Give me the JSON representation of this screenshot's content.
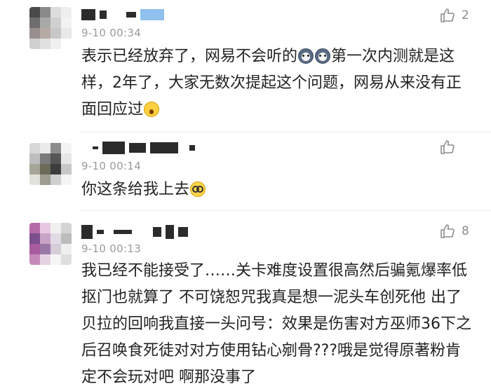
{
  "comments": [
    {
      "time": "9-10 00:34",
      "text_before_emoji": "表示已经放弃了，网易不会听的",
      "emojis": [
        "husky-emoji",
        "husky-emoji"
      ],
      "text_after_emoji": "第一次内测就是这样，2年了，大家无数次提起这个问题，网易从来没有正面回应过",
      "trailing_emoji": "scream-emoji",
      "like_count": "2",
      "avatar_colors": [
        "#4a4a4a",
        "#8a8a8a",
        "#dcdcdc",
        "#eeeeee",
        "#6e6e6e",
        "#a9a9a9",
        "#d0d0d0",
        "#f2f2f2",
        "#9a8f8f",
        "#b6aaa5",
        "#c8c8c8",
        "#e8e8e8",
        "#cfcfcf",
        "#e0e0e0",
        "#f0f0f0",
        "#ffffff"
      ]
    },
    {
      "time": "9-10 00:14",
      "text": "你这条给我上去",
      "trailing_emoji": "glasses-emoji",
      "like_count": "",
      "avatar_colors": [
        "#d8d8d8",
        "#eaeaea",
        "#8c8c8c",
        "#f3f3f3",
        "#bdbdbd",
        "#7a7a7a",
        "#565656",
        "#e6e6e6",
        "#a5a59a",
        "#6b6b58",
        "#3d3d3d",
        "#c7c7c7",
        "#e2e2dc",
        "#9c9c90",
        "#cfcfcf",
        "#f4f4f4"
      ]
    },
    {
      "time": "9-10 00:13",
      "text": "我已经不能接受了……关卡难度设置很高然后骗氪爆率低抠门也就算了 不可饶恕咒我真是想一泥头车创死他 出了贝拉的回响我直接一头问号：效果是伤害对方巫师36下之后召唤食死徒对对方使用钻心剜骨???哦是觉得原著粉肯定不会玩对吧 啊那没事了",
      "like_count": "8",
      "avatar_colors": [
        "#b56aa8",
        "#e8c8e0",
        "#f0f0f0",
        "#d4d4d4",
        "#7a4f8c",
        "#c9a4c6",
        "#e2dbe6",
        "#bcbcbc",
        "#a85b9e",
        "#9a78a6",
        "#d7cdd9",
        "#efefef",
        "#c58bb8",
        "#e6d3e2",
        "#f5f5f5",
        "#dedede"
      ]
    }
  ]
}
